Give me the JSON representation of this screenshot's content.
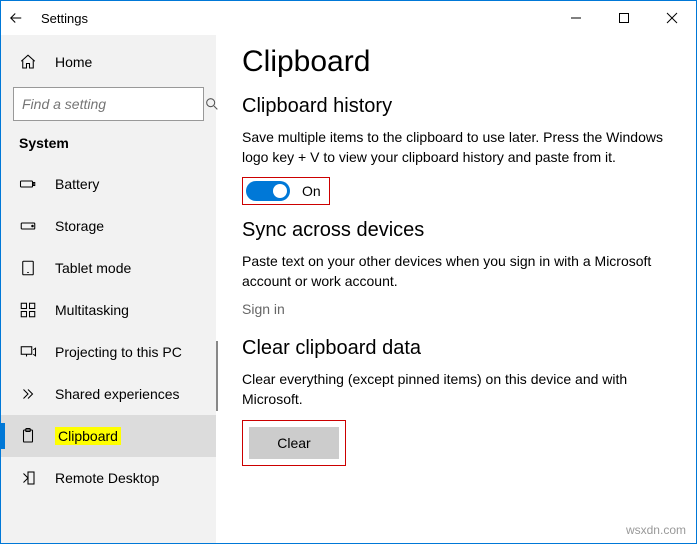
{
  "titlebar": {
    "title": "Settings"
  },
  "sidebar": {
    "home": "Home",
    "search_placeholder": "Find a setting",
    "section": "System",
    "items": [
      {
        "label": "Battery"
      },
      {
        "label": "Storage"
      },
      {
        "label": "Tablet mode"
      },
      {
        "label": "Multitasking"
      },
      {
        "label": "Projecting to this PC"
      },
      {
        "label": "Shared experiences"
      },
      {
        "label": "Clipboard"
      },
      {
        "label": "Remote Desktop"
      }
    ]
  },
  "main": {
    "page_title": "Clipboard",
    "history": {
      "heading": "Clipboard history",
      "desc": "Save multiple items to the clipboard to use later. Press the Windows logo key + V to view your clipboard history and paste from it.",
      "toggle_label": "On"
    },
    "sync": {
      "heading": "Sync across devices",
      "desc": "Paste text on your other devices when you sign in with a Microsoft account or work account.",
      "signin": "Sign in"
    },
    "clear": {
      "heading": "Clear clipboard data",
      "desc": "Clear everything (except pinned items) on this device and with Microsoft.",
      "button": "Clear"
    }
  },
  "watermark": "wsxdn.com"
}
